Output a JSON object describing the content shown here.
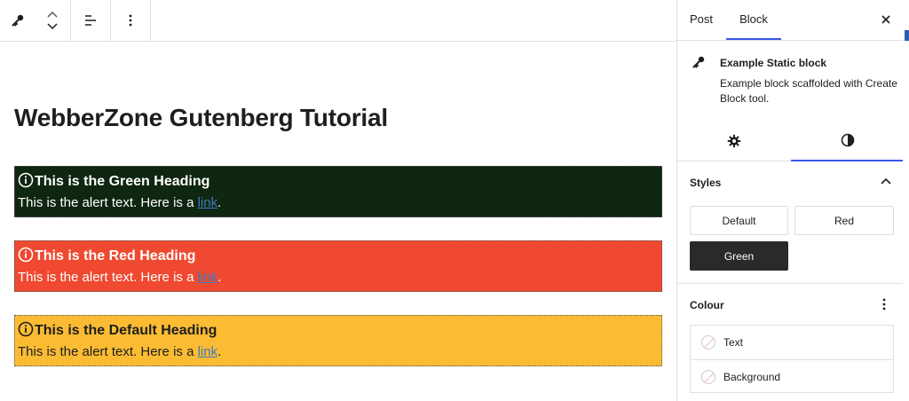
{
  "editor": {
    "post_title": "WebberZone Gutenberg Tutorial",
    "alerts": [
      {
        "heading": "This is the Green Heading",
        "text": "This is the alert text. Here is a ",
        "link": "link",
        "after": ".",
        "style": "green",
        "bg": "#0f2610"
      },
      {
        "heading": "This is the Red Heading",
        "text": "This is the alert text. Here is a ",
        "link": "link",
        "after": ".",
        "style": "red",
        "bg": "#ef4a31"
      },
      {
        "heading": "This is the Default Heading",
        "text": "This is the alert text. Here is a ",
        "link": "link",
        "after": ".",
        "style": "default",
        "bg": "#fbbc33"
      }
    ]
  },
  "toolbar": {
    "icons": [
      "key-icon",
      "chevron-up-icon",
      "chevron-down-icon",
      "align-icon",
      "more-vertical-icon"
    ]
  },
  "sidebar": {
    "tabs": [
      {
        "label": "Post"
      },
      {
        "label": "Block",
        "active": true
      }
    ],
    "block": {
      "title": "Example Static block",
      "description": "Example block scaffolded with Create Block tool."
    },
    "styles": {
      "title": "Styles",
      "options": [
        {
          "label": "Default",
          "selected": false
        },
        {
          "label": "Red",
          "selected": false
        },
        {
          "label": "Green",
          "selected": true
        }
      ]
    },
    "colour": {
      "title": "Colour",
      "items": [
        {
          "label": "Text"
        },
        {
          "label": "Background"
        }
      ]
    }
  },
  "colors": {
    "accent": "#3858e9",
    "green_alert": "#0f2610",
    "red_alert": "#ef4a31",
    "default_alert": "#fbbc33",
    "link": "#3b7bbf"
  }
}
